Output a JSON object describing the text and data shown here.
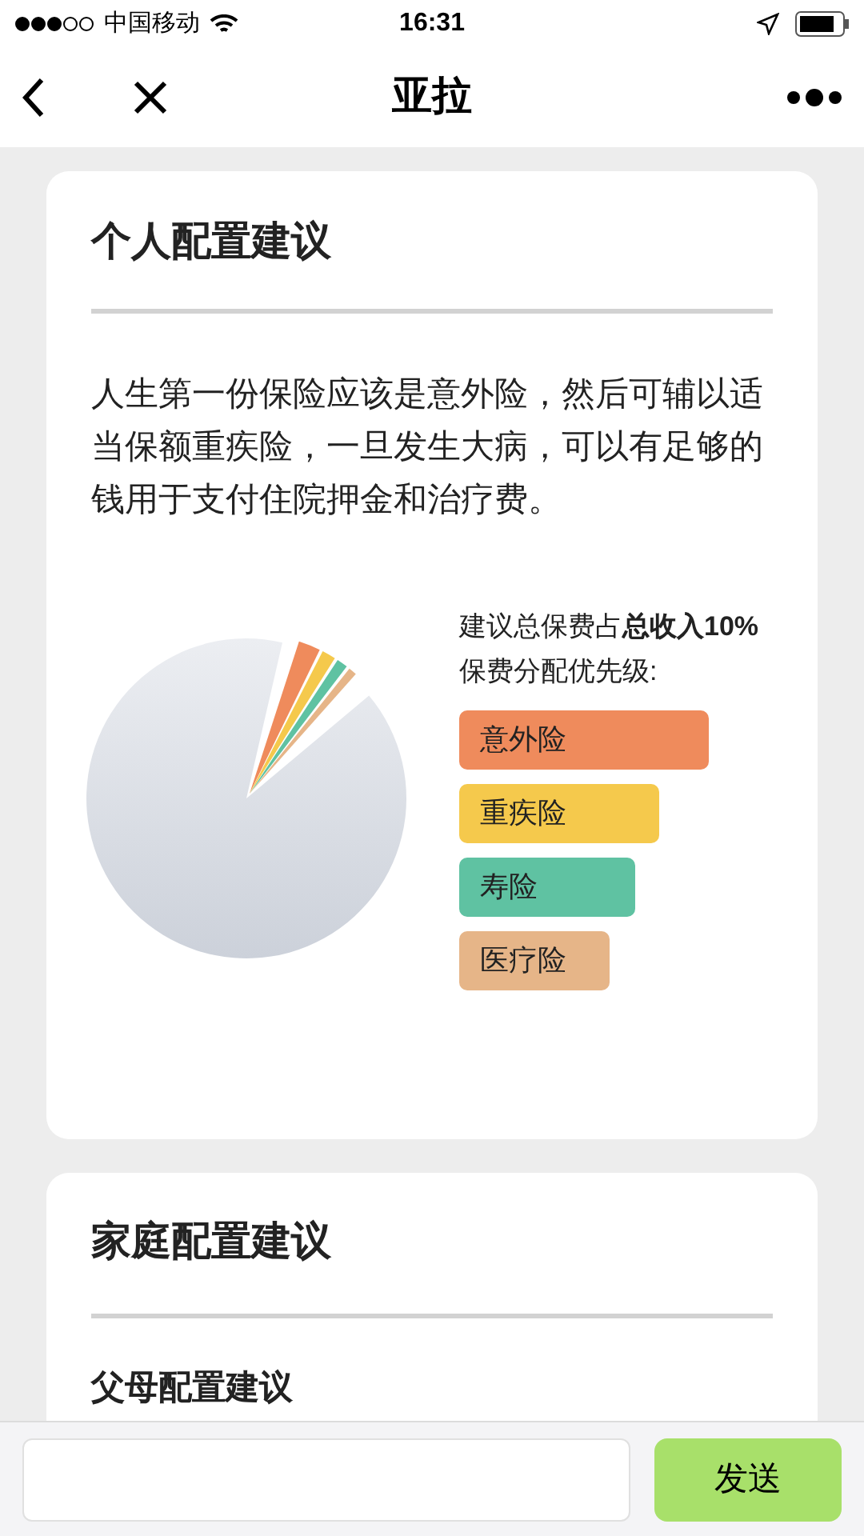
{
  "status_bar": {
    "carrier": "中国移动",
    "time": "16:31"
  },
  "nav": {
    "title": "亚拉"
  },
  "personal": {
    "title": "个人配置建议",
    "description": "人生第一份保险应该是意外险，然后可辅以适当保额重疾险，一旦发生大病，可以有足够的钱用于支付住院押金和治疗费。",
    "summary": "建议总保费占**总收入10%**",
    "priority_label": "保费分配优先级:",
    "priorities": [
      {
        "label": "意外险",
        "color": "#ef8b5c"
      },
      {
        "label": "重疾险",
        "color": "#f5c94c"
      },
      {
        "label": "寿险",
        "color": "#5fc2a2"
      },
      {
        "label": "医疗险",
        "color": "#e6b588"
      }
    ]
  },
  "family": {
    "title": "家庭配置建议",
    "subtitle": "父母配置建议"
  },
  "composer": {
    "send": "发送"
  }
}
